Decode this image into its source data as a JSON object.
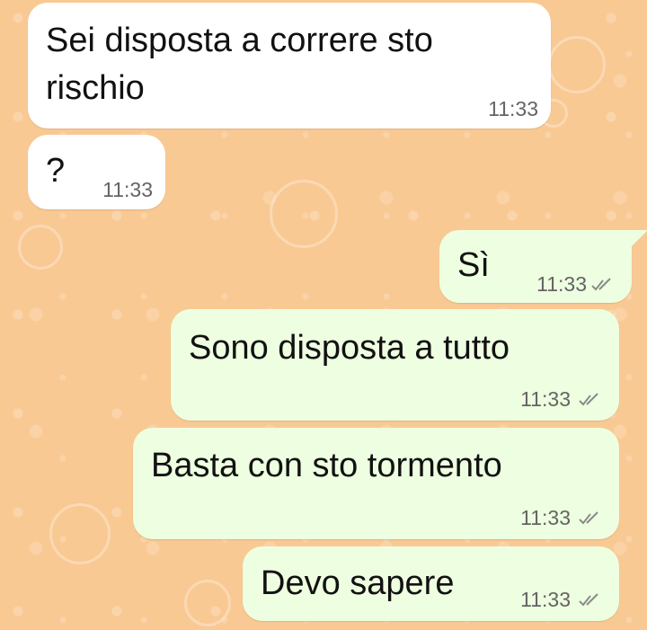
{
  "messages": [
    {
      "direction": "incoming",
      "text": "Sei disposta a correre sto rischio",
      "line1": "Sei disposta a correre sto",
      "line2": "rischio",
      "time": "11:33"
    },
    {
      "direction": "incoming",
      "text": "?",
      "time": "11:33"
    },
    {
      "direction": "outgoing",
      "text": "Sì",
      "time": "11:33",
      "status": "read-double-check-icon"
    },
    {
      "direction": "outgoing",
      "text": "Sono disposta a tutto",
      "time": "11:33",
      "status": "read-double-check-icon"
    },
    {
      "direction": "outgoing",
      "text": "Basta con sto tormento",
      "time": "11:33",
      "status": "read-double-check-icon"
    },
    {
      "direction": "outgoing",
      "text": "Devo sapere",
      "time": "11:33",
      "status": "read-double-check-icon"
    }
  ],
  "colors": {
    "wallpaper": "#f9c994",
    "incoming_bubble": "#ffffff",
    "outgoing_bubble": "#eefee0",
    "timestamp": "#646464",
    "text": "#111111"
  }
}
